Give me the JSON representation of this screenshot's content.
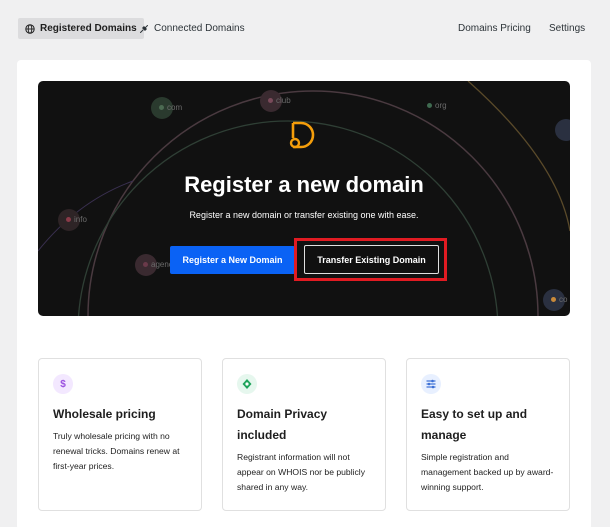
{
  "nav": {
    "tabs": [
      {
        "label": "Registered Domains",
        "icon": "globe-icon",
        "active": true
      },
      {
        "label": "Connected Domains",
        "icon": "plug-icon",
        "active": false
      }
    ],
    "links": [
      {
        "label": "Domains Pricing"
      },
      {
        "label": "Settings"
      }
    ]
  },
  "hero": {
    "title": "Register a new domain",
    "subtitle": "Register a new domain or transfer existing one with ease.",
    "primary_button": "Register a New Domain",
    "secondary_button": "Transfer Existing Domain",
    "tlds": [
      "com",
      "club",
      "org",
      "info",
      "agency",
      "co"
    ],
    "colors": {
      "background": "#111111",
      "accent": "#f59e0b",
      "primary": "#0a62f5",
      "highlight": "#e11b22"
    }
  },
  "features": [
    {
      "icon": "dollar-icon",
      "title": "Wholesale pricing",
      "description": "Truly wholesale pricing with no renewal tricks. Domains renew at first-year prices."
    },
    {
      "icon": "shield-icon",
      "title": "Domain Privacy included",
      "description": "Registrant information will not appear on WHOIS nor be publicly shared in any way."
    },
    {
      "icon": "sliders-icon",
      "title": "Easy to set up and manage",
      "description": "Simple registration and management backed up by award-winning support."
    }
  ]
}
